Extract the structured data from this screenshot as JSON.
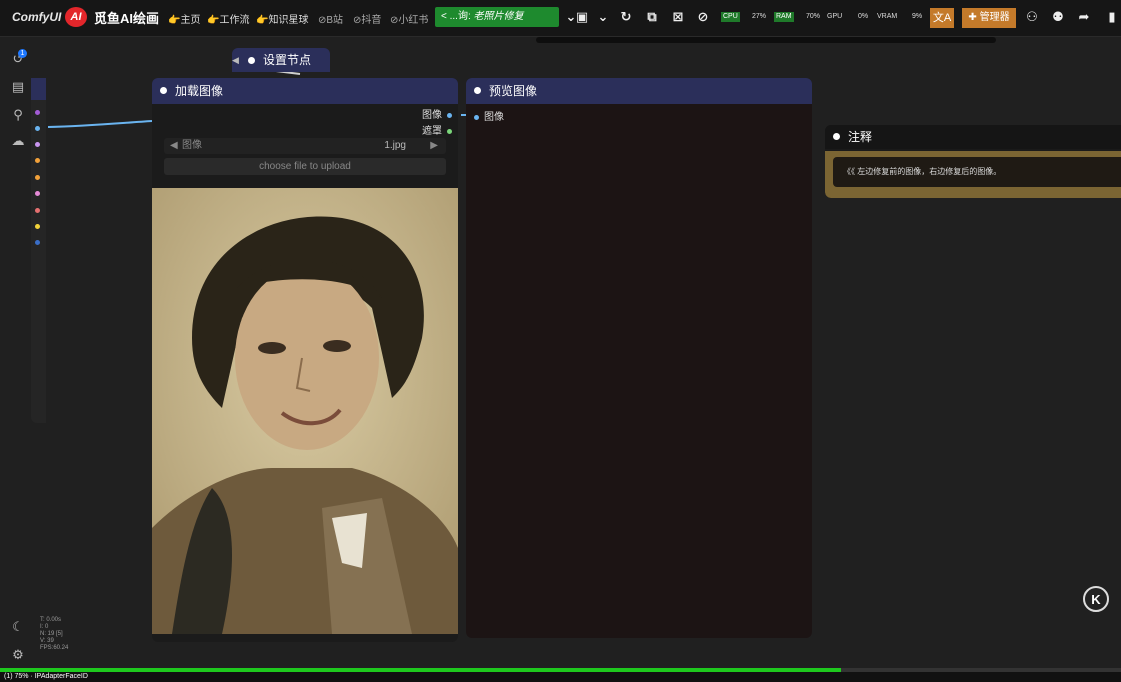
{
  "topbar": {
    "brand": "ComfyUI",
    "logo_mark": "AI",
    "logo_text": "觅鱼AI绘画",
    "links": [
      {
        "label": "👉主页",
        "icon": "pointing-hand-icon"
      },
      {
        "label": "👉工作流",
        "icon": "pointing-hand-icon"
      },
      {
        "label": "👉知识星球",
        "icon": "pointing-hand-icon"
      },
      {
        "label": "⊘B站",
        "icon": "link-icon"
      },
      {
        "label": "⊘抖音",
        "icon": "link-icon"
      },
      {
        "label": "⊘小红书",
        "icon": "link-icon"
      }
    ],
    "workflow_tab": {
      "prefix": "...询:",
      "name": "老照片修复"
    },
    "monitor": {
      "cpu_label": "CPU",
      "cpu_value": "27%",
      "ram_label": "RAM",
      "ram_value": "70%",
      "gpu_label": "GPU",
      "gpu_value": "0%",
      "vram_label": "VRAM",
      "vram_value": "9%"
    },
    "translate_label": "文A",
    "manager_label": "管理器"
  },
  "sidebar": {
    "badge_count": "1",
    "stats": [
      "T: 0.00s",
      "I: 0",
      "N: 19 [5]",
      "V: 39",
      "FPS:60.24"
    ]
  },
  "nodes": {
    "settings": {
      "title": "设置节点"
    },
    "load_image": {
      "title": "加载图像",
      "output_image": "图像",
      "output_mask": "遮罩",
      "combo_label": "图像",
      "combo_value": "1.jpg",
      "upload_label": "choose file to upload"
    },
    "preview": {
      "title": "预览图像",
      "input_image": "图像"
    },
    "note": {
      "title": "注释",
      "text": "《《 左边修复前的图像，右边修复后的图像。"
    }
  },
  "k_badge": "K",
  "progress": {
    "fraction": 0.75,
    "label": "(1) 75% · IPAdapterFaceID"
  },
  "colors": {
    "node_header": "#2b2f5a",
    "note_border": "#7b6533",
    "image_slot": "#6ab4f0",
    "mask_slot": "#7bd67b",
    "progress": "#1ec91e",
    "accent_orange": "#c47a2a"
  }
}
